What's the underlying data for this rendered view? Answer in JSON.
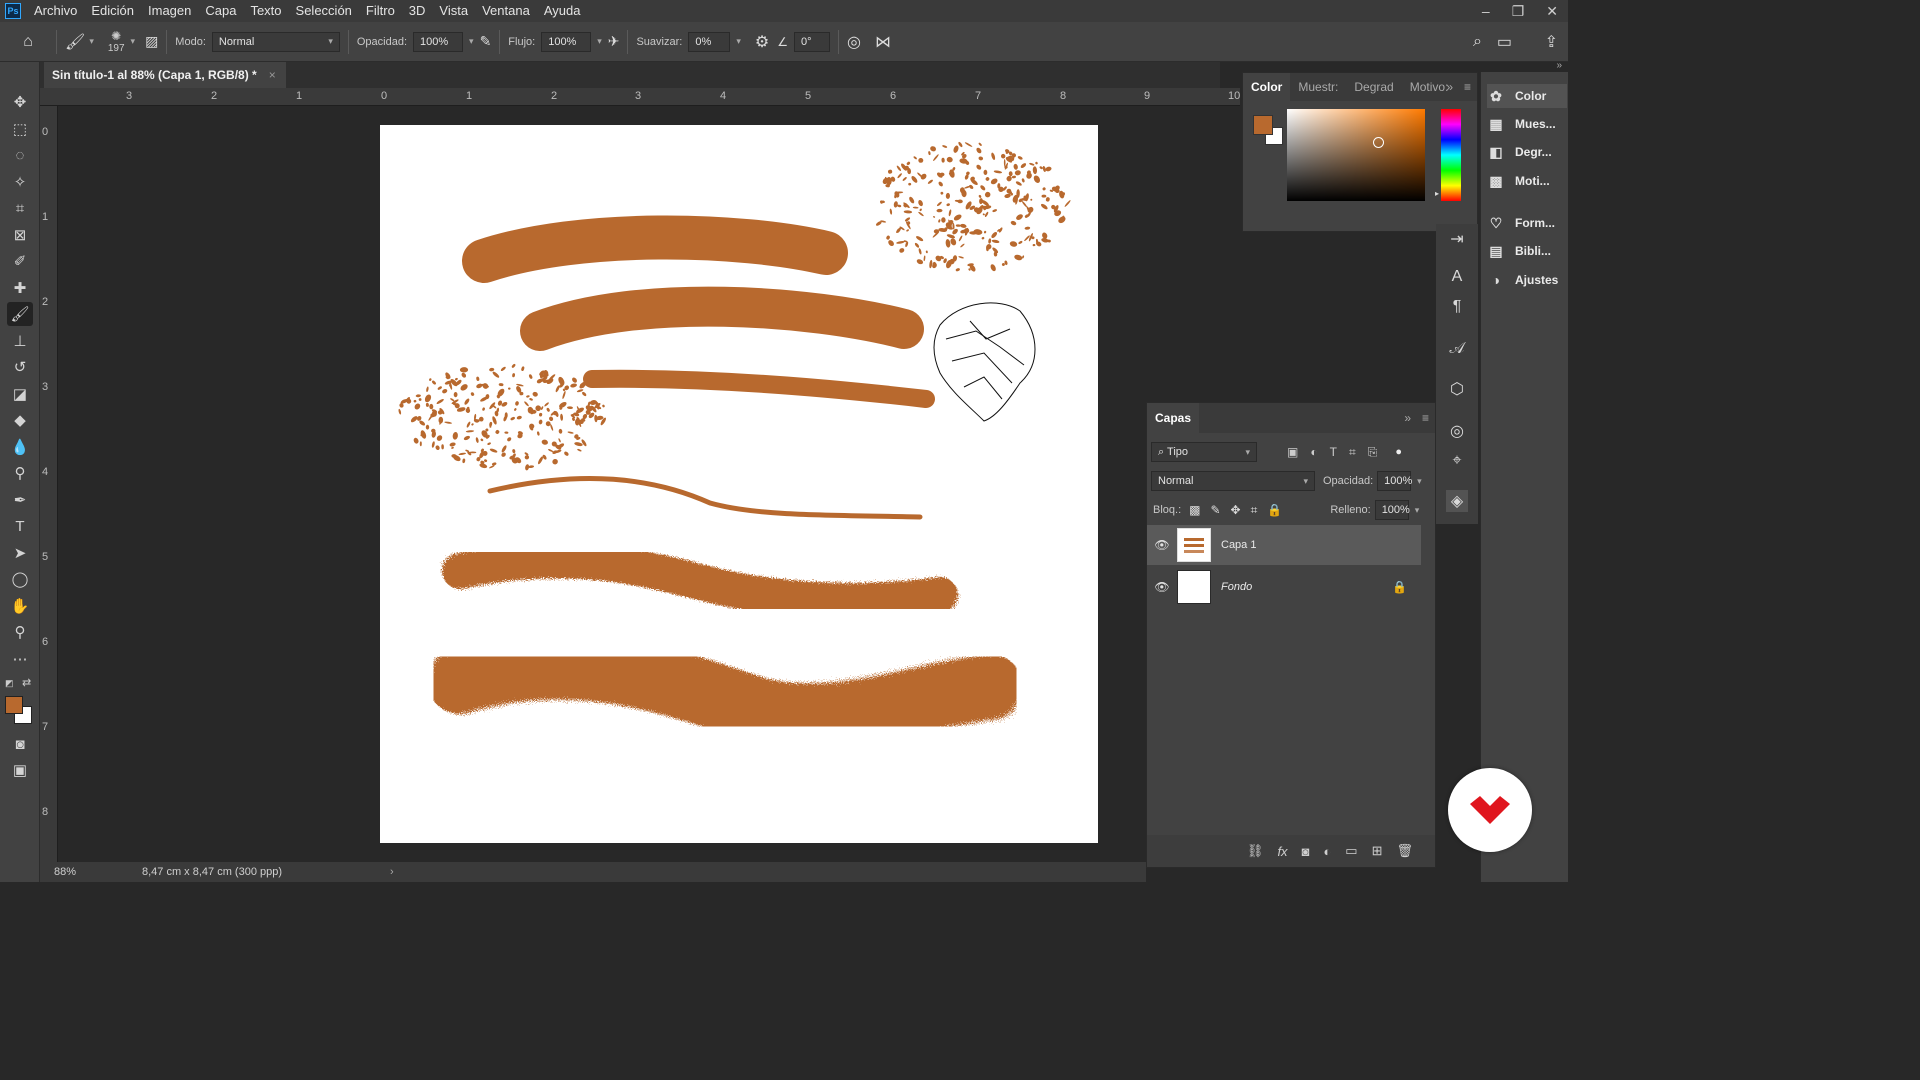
{
  "app": {
    "logo_text": "Ps"
  },
  "menu": [
    "Archivo",
    "Edición",
    "Imagen",
    "Capa",
    "Texto",
    "Selección",
    "Filtro",
    "3D",
    "Vista",
    "Ventana",
    "Ayuda"
  ],
  "options": {
    "brush_size": "197",
    "mode_label": "Modo:",
    "mode_value": "Normal",
    "opacity_label": "Opacidad:",
    "opacity_value": "100%",
    "flow_label": "Flujo:",
    "flow_value": "100%",
    "smoothing_label": "Suavizar:",
    "smoothing_value": "0%",
    "angle_value": "0°"
  },
  "document": {
    "tab_title": "Sin título-1 al 88% (Capa 1, RGB/8) *"
  },
  "rulers": {
    "horizontal": [
      "3",
      "2",
      "1",
      "0",
      "1",
      "2",
      "3",
      "4",
      "5",
      "6",
      "7",
      "8",
      "9",
      "10"
    ],
    "vertical": [
      "0",
      "1",
      "2",
      "3",
      "4",
      "5",
      "6",
      "7",
      "8"
    ]
  },
  "status": {
    "zoom": "88%",
    "doc_info": "8,47 cm x 8,47 cm (300 ppp)"
  },
  "color_panel": {
    "tabs": [
      "Color",
      "Muestr:",
      "Degrad",
      "Motivo:"
    ],
    "foreground": "#b8692e",
    "background": "#ffffff"
  },
  "right_dock": {
    "items": [
      {
        "label": "Color",
        "icon": "color-wheel-icon"
      },
      {
        "label": "Mues...",
        "icon": "swatches-icon"
      },
      {
        "label": "Degr...",
        "icon": "gradient-icon"
      },
      {
        "label": "Moti...",
        "icon": "pattern-icon"
      },
      {
        "label": "Form...",
        "icon": "shapes-icon"
      },
      {
        "label": "Bibli...",
        "icon": "library-icon"
      },
      {
        "label": "Ajustes",
        "icon": "adjustments-icon"
      }
    ]
  },
  "layers_panel": {
    "tab": "Capas",
    "filter_label": "Tipo",
    "blend_mode": "Normal",
    "opacity_label": "Opacidad:",
    "opacity_value": "100%",
    "lock_label": "Bloq.:",
    "fill_label": "Relleno:",
    "fill_value": "100%",
    "layers": [
      {
        "name": "Capa 1",
        "selected": true
      },
      {
        "name": "Fondo",
        "selected": false,
        "locked": true
      }
    ]
  },
  "colors": {
    "brush": "#b8692e",
    "accent_ps": "#31a8ff",
    "badge": "#e0161e"
  }
}
